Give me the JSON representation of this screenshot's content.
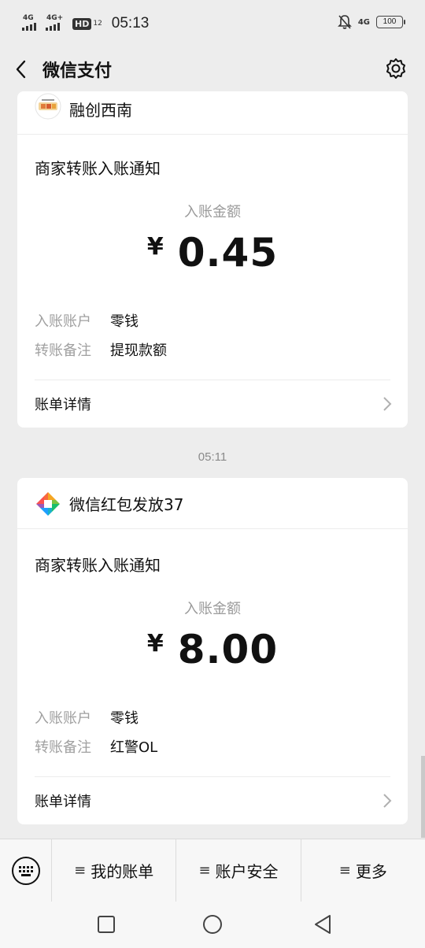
{
  "status_bar": {
    "net1": "4G",
    "net2": "4G+",
    "hd": "HD",
    "hd_sub": "12",
    "time": "05:13",
    "net_right": "4G",
    "battery": "100"
  },
  "nav": {
    "title": "微信支付",
    "back_icon": "chevron-left-icon",
    "settings_icon": "gear-icon"
  },
  "messages": [
    {
      "sender": "融创西南",
      "title": "商家转账入账通知",
      "amount_label": "入账金额",
      "currency": "¥",
      "amount": "0.45",
      "account_label": "入账账户",
      "account_value": "零钱",
      "note_label": "转账备注",
      "note_value": "提现款额",
      "detail_label": "账单详情"
    },
    {
      "timestamp": "05:11",
      "sender": "微信红包发放37",
      "title": "商家转账入账通知",
      "amount_label": "入账金额",
      "currency": "¥",
      "amount": "8.00",
      "account_label": "入账账户",
      "account_value": "零钱",
      "note_label": "转账备注",
      "note_value": "红警OL",
      "detail_label": "账单详情"
    }
  ],
  "bottom_menu": {
    "keyboard_icon": "keyboard-icon",
    "items": [
      "我的账单",
      "账户安全",
      "更多"
    ],
    "prefix": "≡"
  },
  "colors": {
    "background": "#ededed",
    "card": "#ffffff",
    "muted": "#9a9a9a"
  }
}
